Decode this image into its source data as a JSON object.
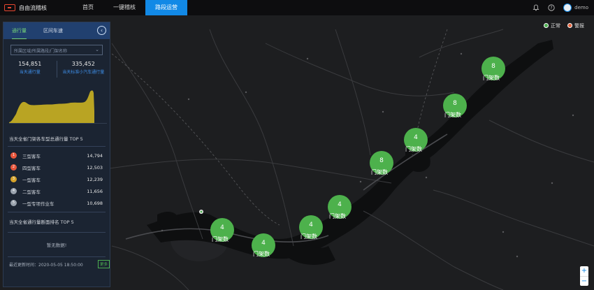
{
  "app": {
    "title": "自由流稽核"
  },
  "nav": {
    "items": [
      {
        "label": "首页"
      },
      {
        "label": "一键稽核"
      },
      {
        "label": "路段运营"
      }
    ]
  },
  "header": {
    "user": "demo"
  },
  "legend": {
    "normal": "正常",
    "alarm": "警报",
    "normal_color": "#4caf50",
    "alarm_color": "#e8643c"
  },
  "panel": {
    "tabs": [
      {
        "label": "通行量"
      },
      {
        "label": "区间车速"
      }
    ],
    "select_placeholder": "所属区域/所属路段/门架名称",
    "stats": [
      {
        "value": "154,851",
        "label": "当天通行量"
      },
      {
        "value": "335,452",
        "label": "当天标准小汽车通行量"
      }
    ],
    "area_chart_color": "#b9a423",
    "rank_title": "当天全省门架各车型总通行量 TOP 5",
    "rank_items": [
      {
        "rank": "1",
        "name": "三型客车",
        "value": "14,794",
        "color": "#e8563c"
      },
      {
        "rank": "2",
        "name": "四型客车",
        "value": "12,503",
        "color": "#e8563c"
      },
      {
        "rank": "3",
        "name": "一型客车",
        "value": "12,239",
        "color": "#d6a32b"
      },
      {
        "rank": "4",
        "name": "二型客车",
        "value": "11,656",
        "color": "#9aa3ae"
      },
      {
        "rank": "5",
        "name": "一型专项作业车",
        "value": "10,698",
        "color": "#9aa3ae"
      }
    ],
    "rank2_title": "当天全省通行量断面排名 TOP 5",
    "empty_text": "暂无数据!",
    "update_text": "最近更新时间：2020-05-05 18:50:00",
    "update_btn": "更多"
  },
  "clusters": [
    {
      "count": "8",
      "label": "门架数"
    },
    {
      "count": "8",
      "label": "门架数"
    },
    {
      "count": "4",
      "label": "门架数"
    },
    {
      "count": "8",
      "label": "门架数"
    },
    {
      "count": "4",
      "label": "门架数"
    },
    {
      "count": "4",
      "label": "门架数"
    },
    {
      "count": "4",
      "label": "门架数"
    },
    {
      "count": "4",
      "label": "门架数"
    }
  ],
  "zoom": {
    "in": "+",
    "out": "−"
  }
}
